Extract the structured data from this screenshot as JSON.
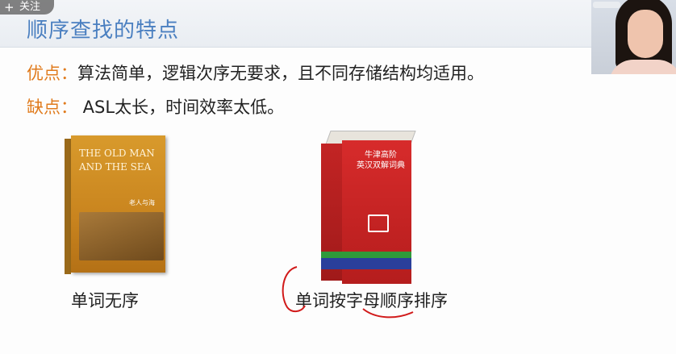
{
  "follow_button": {
    "plus": "+",
    "label": "关注"
  },
  "slide": {
    "title": "顺序查找的特点",
    "advantage": {
      "key": "优点：",
      "text": "算法简单，逻辑次序无要求，且不同存储结构均适用。"
    },
    "disadvantage": {
      "key": "缺点：",
      "text": " ASL太长，时间效率太低。"
    },
    "book_left": {
      "title_line1": "THE OLD MAN",
      "title_line2": "AND THE SEA",
      "cn_title": "老人与海"
    },
    "book_right": {
      "title_line1": "牛津高阶",
      "title_line2": "英汉双解词典"
    },
    "caption_left": "单词无序",
    "caption_right": "单词按字母顺序排序"
  },
  "colors": {
    "title": "#4a7fc0",
    "key": "#e07b1d",
    "ink": "#d11a1a"
  }
}
